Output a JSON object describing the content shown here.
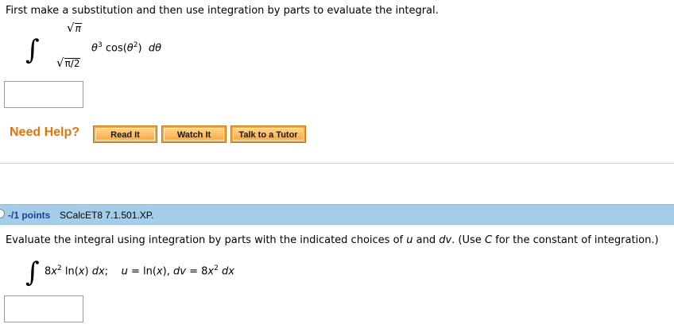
{
  "question1": {
    "prompt": "First make a substitution and then use integration by parts to evaluate the integral.",
    "integral": {
      "upper_limit": "π",
      "lower_limit": "π/2",
      "integrand_var": "θ",
      "integrand_exp": "3",
      "integrand_func": "cos(",
      "inner_var": "θ",
      "inner_exp": "2",
      "integrand_close": ")",
      "differential_d": "d",
      "differential_var": "θ"
    },
    "answer_value": ""
  },
  "help": {
    "label": "Need Help?",
    "buttons": [
      "Read It",
      "Watch It",
      "Talk to a Tutor"
    ]
  },
  "question2": {
    "points": "-/1 points",
    "source": "SCalcET8 7.1.501.XP.",
    "prompt_parts": [
      "Evaluate the integral using integration by parts with the indicated choices of ",
      "u",
      " and ",
      "dv",
      ". (Use ",
      "C",
      " for the constant of integration.)"
    ],
    "integral": {
      "coef": "8",
      "var": "x",
      "exp": "2",
      "func": " ln(",
      "inner": "x",
      "close": ") ",
      "dx_d": "d",
      "dx_x": "x",
      "sep": ";",
      "u_label": "u",
      "eq1": " = ln(",
      "u_inner": "x",
      "u_close": "), ",
      "dv_label": "dv",
      "eq2": " = 8",
      "dv_var": "x",
      "dv_exp": "2",
      "dv_d": " d",
      "dv_x": "x"
    },
    "answer_value": ""
  },
  "colors": {
    "need_help": "#e8720c",
    "header_bar": "#a3cde8",
    "points_text": "#1b3f8f",
    "button_fill": "#f9a942"
  }
}
